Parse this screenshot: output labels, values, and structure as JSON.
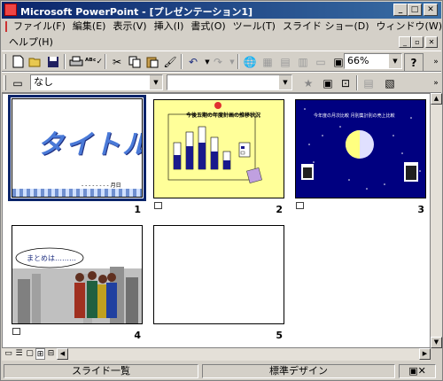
{
  "titlebar": {
    "title": "Microsoft PowerPoint - [プレゼンテーション1]"
  },
  "menu": {
    "items": [
      "ファイル(F)",
      "編集(E)",
      "表示(V)",
      "挿入(I)",
      "書式(O)",
      "ツール(T)",
      "スライド ショー(D)",
      "ウィンドウ(W)"
    ],
    "help": "ヘルプ(H)"
  },
  "toolbar": {
    "zoom": "66%"
  },
  "formatting": {
    "style": "なし",
    "font": ""
  },
  "slides": [
    {
      "number": "1",
      "title": "タイトル",
      "footer": "- - - - - - - - 月日",
      "selected": true
    },
    {
      "number": "2",
      "chart_title": "今後五期の年度計画の推移状況"
    },
    {
      "number": "3",
      "caption": "今年度の月次比較 月別集計別の売上比較"
    },
    {
      "number": "4",
      "speech": "まとめは………"
    },
    {
      "number": "5"
    }
  ],
  "status": {
    "view": "スライド一覧",
    "design": "標準デザイン"
  },
  "colors": {
    "titlebar": "#0a246a",
    "slide2_bg": "#ffff99",
    "slide3_bg": "#000080",
    "bar_blue": "#1a1a8c"
  }
}
